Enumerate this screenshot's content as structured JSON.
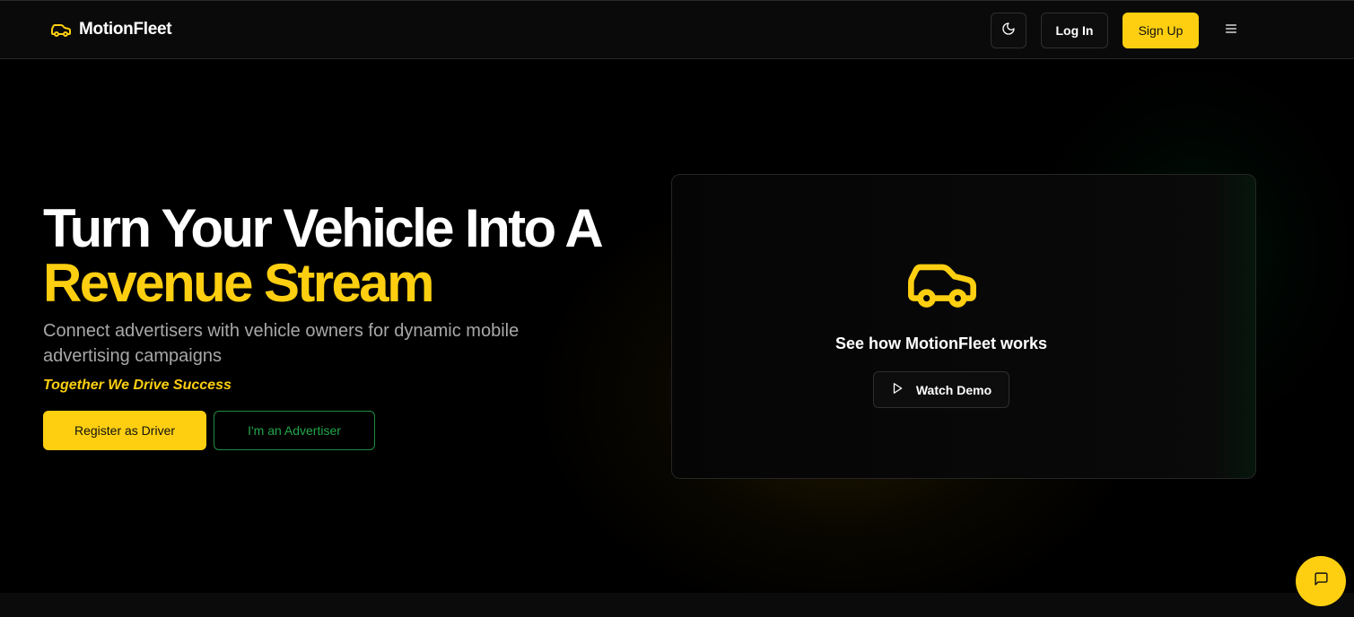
{
  "header": {
    "brand_name": "MotionFleet",
    "brand_icon": "car-icon",
    "theme_icon": "moon-icon",
    "login_label": "Log In",
    "signup_label": "Sign Up",
    "menu_icon": "menu-icon"
  },
  "hero": {
    "title_line1": "Turn Your Vehicle Into A",
    "title_line2": "Revenue Stream",
    "subtitle": "Connect advertisers with vehicle owners for dynamic mobile advertising campaigns",
    "tagline": "Together We Drive Success",
    "driver_button": "Register as Driver",
    "advertiser_button": "I'm an Advertiser"
  },
  "demo": {
    "icon": "car-icon",
    "heading": "See how MotionFleet works",
    "watch_label": "Watch Demo",
    "watch_icon": "play-icon"
  },
  "chat": {
    "icon": "chat-icon"
  },
  "colors": {
    "accent": "#fdcf10",
    "green": "#22a64a",
    "background": "#000000"
  }
}
